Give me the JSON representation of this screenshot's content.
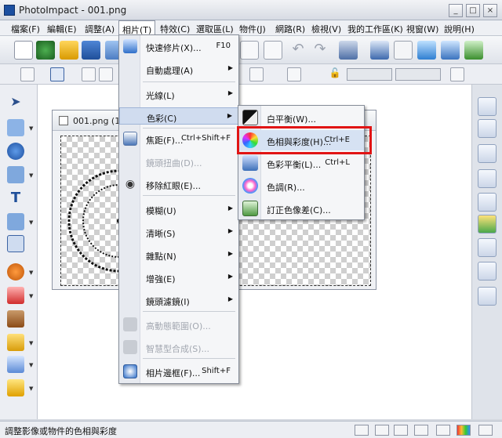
{
  "window": {
    "title": "PhotoImpact - 001.png",
    "controls": [
      "_",
      "□",
      "×"
    ]
  },
  "menubar": [
    "檔案(F)",
    "編輯(E)",
    "調整(A)",
    "相片(T)",
    "特效(C)",
    "選取區(L)",
    "物件(J)",
    "網路(R)",
    "檢視(V)",
    "我的工作區(K)",
    "視窗(W)",
    "說明(H)"
  ],
  "document": {
    "title": "001.png (10"
  },
  "photo_menu": {
    "items": [
      {
        "label": "快速修片(X)...",
        "shortcut": "F10"
      },
      {
        "label": "自動處理(A)",
        "submenu": "▶"
      },
      {
        "label": "光線(L)",
        "submenu": "▶"
      },
      {
        "label": "色彩(C)",
        "submenu": "▶"
      },
      {
        "label": "焦距(F)...",
        "shortcut": "Ctrl+Shift+F"
      },
      {
        "label": "鏡頭扭曲(D)..."
      },
      {
        "label": "移除紅眼(E)..."
      },
      {
        "label": "模糊(U)",
        "submenu": "▶"
      },
      {
        "label": "清晰(S)",
        "submenu": "▶"
      },
      {
        "label": "雜點(N)",
        "submenu": "▶"
      },
      {
        "label": "增強(E)",
        "submenu": "▶"
      },
      {
        "label": "鏡頭濾鏡(I)",
        "submenu": "▶"
      },
      {
        "label": "高動態範圍(O)..."
      },
      {
        "label": "智慧型合成(S)..."
      },
      {
        "label": "相片邊框(F)...",
        "shortcut": "Shift+F"
      }
    ]
  },
  "color_submenu": {
    "items": [
      {
        "label": "白平衡(W)...",
        "shortcut": ""
      },
      {
        "label": "色相與彩度(H)...",
        "shortcut": "Ctrl+E"
      },
      {
        "label": "色彩平衡(L)...",
        "shortcut": "Ctrl+L"
      },
      {
        "label": "色調(R)...",
        "shortcut": ""
      },
      {
        "label": "訂正色像差(C)...",
        "shortcut": ""
      }
    ]
  },
  "statusbar": {
    "text": "調整影像或物件的色相與彩度"
  },
  "colors": {
    "highlight_box": "#e11414",
    "menu_highlight": "#d0dcef"
  }
}
